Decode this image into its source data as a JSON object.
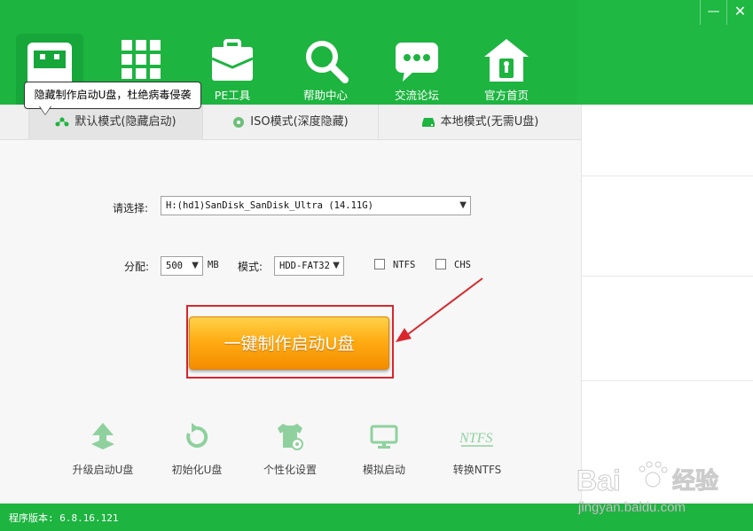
{
  "window": {
    "minimize_glyph": "—",
    "close_glyph": "✕"
  },
  "nav": {
    "items": [
      {
        "label": "PE工具",
        "icon": "briefcase-icon"
      },
      {
        "label": "帮助中心",
        "icon": "search-icon"
      },
      {
        "label": "交流论坛",
        "icon": "chat-bubble-icon"
      },
      {
        "label": "官方首页",
        "icon": "home-icon"
      }
    ]
  },
  "tooltip": {
    "text": "隐藏制作启动U盘，杜绝病毒侵袭"
  },
  "tabs": [
    {
      "label": "默认模式(隐藏启动)",
      "active": true
    },
    {
      "label": "ISO模式(深度隐藏)",
      "active": false
    },
    {
      "label": "本地模式(无需U盘)",
      "active": false
    }
  ],
  "form": {
    "select_label": "请选择:",
    "device_value": "H:(hd1)SanDisk_SanDisk_Ultra (14.11G)",
    "alloc_label": "分配:",
    "alloc_value": "500",
    "alloc_unit": "MB",
    "mode_label": "模式:",
    "mode_value": "HDD-FAT32",
    "ntfs_label": "NTFS",
    "chs_label": "CHS"
  },
  "make_button": {
    "label": "一键制作启动U盘"
  },
  "tools": [
    {
      "label": "升级启动U盘",
      "icon": "upload-icon"
    },
    {
      "label": "初始化U盘",
      "icon": "refresh-icon"
    },
    {
      "label": "个性化设置",
      "icon": "tshirt-gear-icon"
    },
    {
      "label": "模拟启动",
      "icon": "monitor-icon"
    },
    {
      "label": "转换NTFS",
      "icon": "ntfs-icon"
    }
  ],
  "tool_icon_text": {
    "ntfs": "NTFS"
  },
  "footer": {
    "version": "程序版本: 6.8.16.121"
  },
  "watermark": {
    "brand": "Bai",
    "brand2": "经验",
    "url": "jingyan.baidu.com"
  },
  "colors": {
    "brand_green": "#1db440",
    "accent_orange": "#ffad14",
    "highlight_red": "#d9262c"
  }
}
